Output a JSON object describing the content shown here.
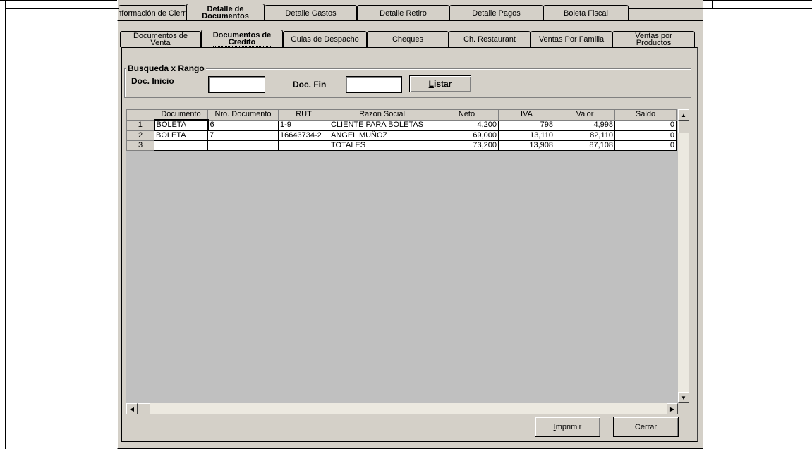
{
  "tabs_top": [
    {
      "label": "Información de Cierre"
    },
    {
      "label_line1": "Detalle de",
      "label_line2": "Documentos"
    },
    {
      "label": "Detalle Gastos"
    },
    {
      "label": "Detalle Retiro"
    },
    {
      "label": "Detalle Pagos"
    },
    {
      "label": "Boleta Fiscal"
    }
  ],
  "tabs_sub": [
    {
      "label_line1": "Documentos de",
      "label_line2": "Venta"
    },
    {
      "label_line1": "Documentos de",
      "label_line2": "Credito"
    },
    {
      "label": "Guias de Despacho"
    },
    {
      "label": "Cheques"
    },
    {
      "label": "Ch. Restaurant"
    },
    {
      "label": "Ventas Por Familia"
    },
    {
      "label_line1": "Ventas por",
      "label_line2": "Productos"
    }
  ],
  "search": {
    "group_title": "Busqueda x Rango",
    "inicio_label": "Doc. Inicio",
    "inicio_value": "",
    "fin_label": "Doc. Fin",
    "fin_value": "",
    "listar_label_acc": "L",
    "listar_label_rest": "istar"
  },
  "grid": {
    "columns": [
      "",
      "Documento",
      "Nro. Documento",
      "RUT",
      "Razón Social",
      "Neto",
      "IVA",
      "Valor",
      "Saldo"
    ],
    "rows": [
      {
        "n": "1",
        "documento": "BOLETA",
        "nro": "6",
        "rut": "1-9",
        "razon": "CLIENTE PARA BOLETAS",
        "neto": "4,200",
        "iva": "798",
        "valor": "4,998",
        "saldo": "0"
      },
      {
        "n": "2",
        "documento": "BOLETA",
        "nro": "7",
        "rut": "16643734-2",
        "razon": "ANGEL MUÑOZ",
        "neto": "69,000",
        "iva": "13,110",
        "valor": "82,110",
        "saldo": "0"
      },
      {
        "n": "3",
        "documento": "",
        "nro": "",
        "rut": "",
        "razon": "TOTALES",
        "neto": "73,200",
        "iva": "13,908",
        "valor": "87,108",
        "saldo": "0"
      }
    ]
  },
  "buttons": {
    "imprimir_acc": "I",
    "imprimir_rest": "mprimir",
    "cerrar": "Cerrar"
  },
  "icons": {
    "scroll_up": "scroll-up-icon",
    "scroll_down": "scroll-down-icon",
    "scroll_left": "scroll-left-icon",
    "scroll_right": "scroll-right-icon"
  }
}
